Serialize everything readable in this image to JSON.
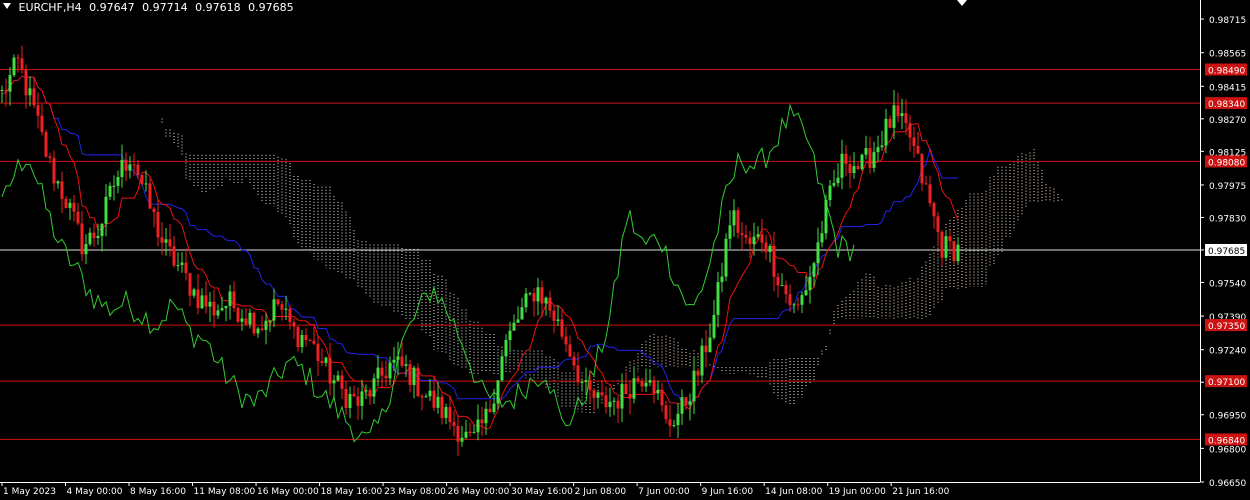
{
  "header": {
    "symbol": "EURCHF,H4",
    "open": "0.97647",
    "high": "0.97714",
    "low": "0.97618",
    "close": "0.97685"
  },
  "colors": {
    "background": "#000000",
    "candle_up": "#44dd44",
    "candle_down": "#ee2222",
    "kijun": "#2222ee",
    "tenkan": "#ee1111",
    "chikou": "#33cc33",
    "cloud_bull": "#ffe8d0",
    "cloud_bear": "#f0f0f0",
    "level_line": "#cc1111",
    "price_line": "#e0e0e0",
    "axis": "#ffffff"
  },
  "chart_data": {
    "type": "candlestick",
    "ylim": [
      0.9665,
      0.988
    ],
    "y_ticks": [
      "0.98715",
      "0.98565",
      "0.98415",
      "0.98270",
      "0.98125",
      "0.97975",
      "0.97830",
      "0.97685",
      "0.97540",
      "0.97390",
      "0.97240",
      "0.97095",
      "0.96950",
      "0.96800",
      "0.96650"
    ],
    "x_ticks": [
      "1 May 2023",
      "4 May 00:00",
      "8 May 16:00",
      "11 May 08:00",
      "16 May 00:00",
      "18 May 16:00",
      "23 May 08:00",
      "26 May 00:00",
      "30 May 16:00",
      "2 Jun 08:00",
      "7 Jun 00:00",
      "9 Jun 16:00",
      "14 Jun 08:00",
      "19 Jun 00:00",
      "21 Jun 16:00"
    ],
    "levels": [
      {
        "value": 0.9849,
        "label": "0.98490"
      },
      {
        "value": 0.9834,
        "label": "0.98340"
      },
      {
        "value": 0.9808,
        "label": "0.98080"
      },
      {
        "value": 0.9735,
        "label": "0.97350"
      },
      {
        "value": 0.971,
        "label": "0.97100"
      },
      {
        "value": 0.9684,
        "label": "0.96840"
      }
    ],
    "current_price": {
      "value": 0.97685,
      "label": "0.97685"
    },
    "price_path": [
      0.9838,
      0.9852,
      0.983,
      0.9805,
      0.979,
      0.977,
      0.9778,
      0.98,
      0.9812,
      0.979,
      0.977,
      0.976,
      0.9748,
      0.9742,
      0.9745,
      0.974,
      0.9735,
      0.9745,
      0.9732,
      0.9728,
      0.9715,
      0.9705,
      0.97,
      0.9708,
      0.9718,
      0.9715,
      0.9705,
      0.9698,
      0.969,
      0.9682,
      0.9695,
      0.9725,
      0.974,
      0.9752,
      0.974,
      0.9725,
      0.9705,
      0.97,
      0.9702,
      0.971,
      0.9715,
      0.969,
      0.9698,
      0.9715,
      0.974,
      0.9785,
      0.977,
      0.9775,
      0.9755,
      0.974,
      0.976,
      0.979,
      0.981,
      0.9805,
      0.9815,
      0.9828,
      0.982,
      0.9795,
      0.977,
      0.9769
    ]
  }
}
